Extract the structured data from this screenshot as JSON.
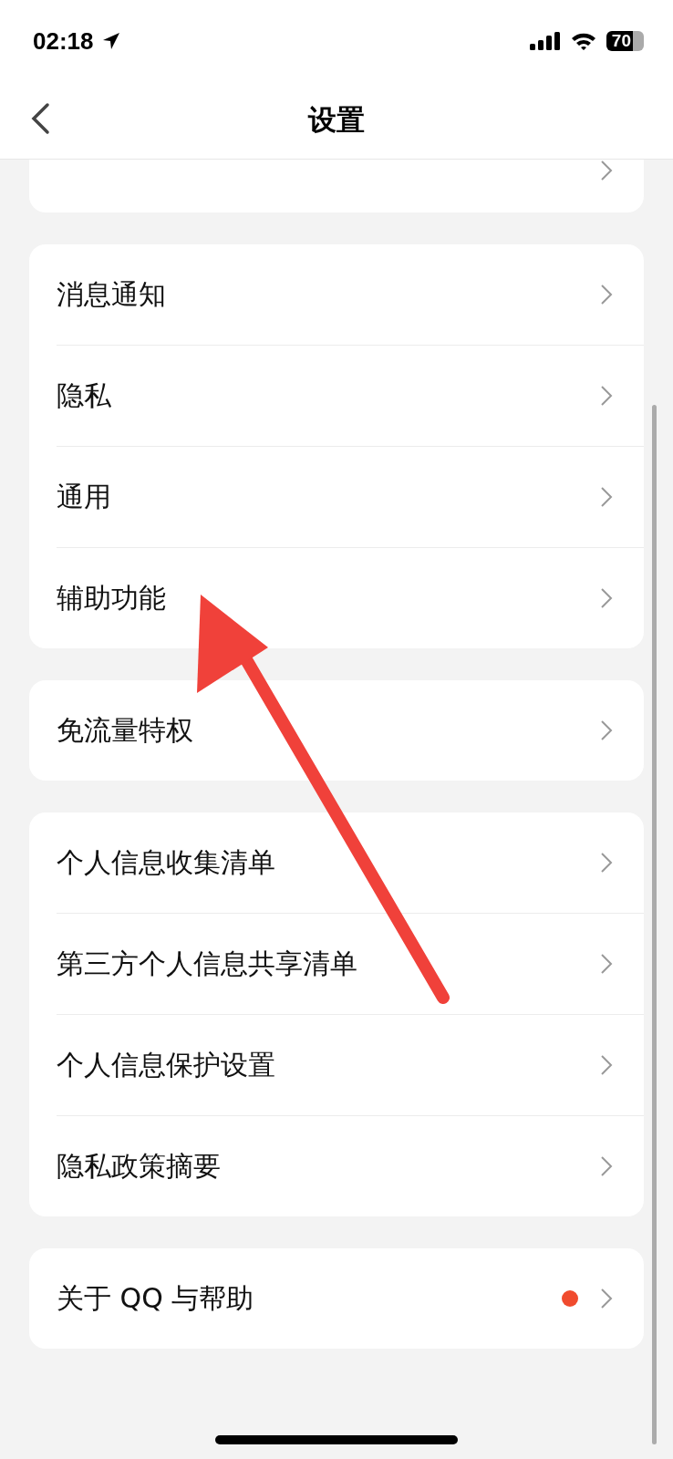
{
  "status_bar": {
    "time": "02:18",
    "battery": "70"
  },
  "header": {
    "title": "设置"
  },
  "groups": [
    {
      "items": [
        {
          "label": "消息通知",
          "dot": false
        },
        {
          "label": "隐私",
          "dot": false
        },
        {
          "label": "通用",
          "dot": false
        },
        {
          "label": "辅助功能",
          "dot": false
        }
      ]
    },
    {
      "items": [
        {
          "label": "免流量特权",
          "dot": false
        }
      ]
    },
    {
      "items": [
        {
          "label": "个人信息收集清单",
          "dot": false
        },
        {
          "label": "第三方个人信息共享清单",
          "dot": false
        },
        {
          "label": "个人信息保护设置",
          "dot": false
        },
        {
          "label": "隐私政策摘要",
          "dot": false
        }
      ]
    },
    {
      "items": [
        {
          "label": "关于 QQ 与帮助",
          "dot": true
        }
      ]
    }
  ]
}
